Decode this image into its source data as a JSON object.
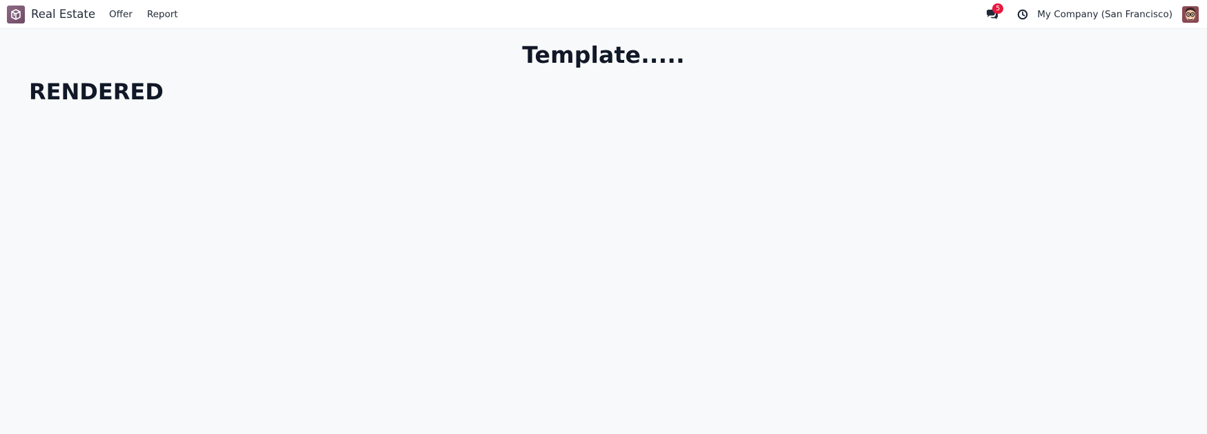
{
  "navbar": {
    "app_name": "Real Estate",
    "menu": [
      {
        "label": "Offer"
      },
      {
        "label": "Report"
      }
    ],
    "messages_badge": "5",
    "company": "My Company (San Francisco)",
    "colors": {
      "brand": "#714B67",
      "badge": "#E8193C"
    },
    "icons": [
      "app-logo-icon",
      "chat-icon",
      "clock-icon",
      "user-avatar"
    ]
  },
  "main": {
    "title": "Template.....",
    "heading": "RENDERED"
  }
}
